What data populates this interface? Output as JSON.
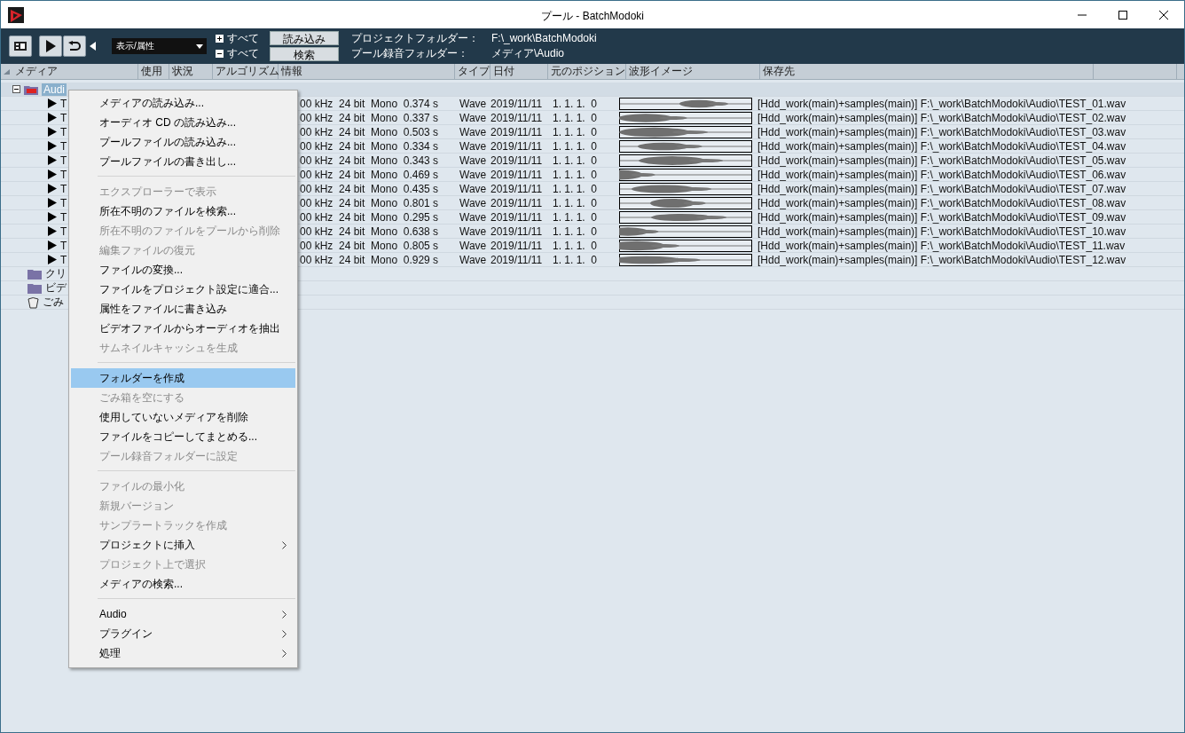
{
  "window": {
    "title": "プール - BatchModoki"
  },
  "toolbar": {
    "view_dropdown": "表示/属性",
    "expand_all": "すべて",
    "collapse_all": "すべて",
    "buttons": [
      "読み込み",
      "検索"
    ],
    "fields": [
      {
        "label": "プロジェクトフォルダー：",
        "value": "F:\\_work\\BatchModoki"
      },
      {
        "label": "プール録音フォルダー：",
        "value": "メディア\\Audio"
      }
    ]
  },
  "table": {
    "columns": [
      "メディア",
      "使用",
      "状況",
      "アルゴリズム",
      "情報",
      "タイプ",
      "日付",
      "元のポジション",
      "波形イメージ",
      "保存先"
    ],
    "folders": [
      {
        "name": "Audi",
        "kind": "audio",
        "expanded": true,
        "selected": true,
        "children": [
          {
            "name": "T",
            "info": "00 kHz  24 bit  Mono  0.374 s",
            "type": "Wave",
            "date": "2019/11/11",
            "position": "1. 1. 1.  0",
            "path": "[Hdd_work(main)+samples(main)] F:\\_work\\BatchModoki\\Audio\\TEST_01.wav"
          },
          {
            "name": "T",
            "info": "00 kHz  24 bit  Mono  0.337 s",
            "type": "Wave",
            "date": "2019/11/11",
            "position": "1. 1. 1.  0",
            "path": "[Hdd_work(main)+samples(main)] F:\\_work\\BatchModoki\\Audio\\TEST_02.wav"
          },
          {
            "name": "T",
            "info": "00 kHz  24 bit  Mono  0.503 s",
            "type": "Wave",
            "date": "2019/11/11",
            "position": "1. 1. 1.  0",
            "path": "[Hdd_work(main)+samples(main)] F:\\_work\\BatchModoki\\Audio\\TEST_03.wav"
          },
          {
            "name": "T",
            "info": "00 kHz  24 bit  Mono  0.334 s",
            "type": "Wave",
            "date": "2019/11/11",
            "position": "1. 1. 1.  0",
            "path": "[Hdd_work(main)+samples(main)] F:\\_work\\BatchModoki\\Audio\\TEST_04.wav"
          },
          {
            "name": "T",
            "info": "00 kHz  24 bit  Mono  0.343 s",
            "type": "Wave",
            "date": "2019/11/11",
            "position": "1. 1. 1.  0",
            "path": "[Hdd_work(main)+samples(main)] F:\\_work\\BatchModoki\\Audio\\TEST_05.wav"
          },
          {
            "name": "T",
            "info": "00 kHz  24 bit  Mono  0.469 s",
            "type": "Wave",
            "date": "2019/11/11",
            "position": "1. 1. 1.  0",
            "path": "[Hdd_work(main)+samples(main)] F:\\_work\\BatchModoki\\Audio\\TEST_06.wav"
          },
          {
            "name": "T",
            "info": "00 kHz  24 bit  Mono  0.435 s",
            "type": "Wave",
            "date": "2019/11/11",
            "position": "1. 1. 1.  0",
            "path": "[Hdd_work(main)+samples(main)] F:\\_work\\BatchModoki\\Audio\\TEST_07.wav"
          },
          {
            "name": "T",
            "info": "00 kHz  24 bit  Mono  0.801 s",
            "type": "Wave",
            "date": "2019/11/11",
            "position": "1. 1. 1.  0",
            "path": "[Hdd_work(main)+samples(main)] F:\\_work\\BatchModoki\\Audio\\TEST_08.wav"
          },
          {
            "name": "T",
            "info": "00 kHz  24 bit  Mono  0.295 s",
            "type": "Wave",
            "date": "2019/11/11",
            "position": "1. 1. 1.  0",
            "path": "[Hdd_work(main)+samples(main)] F:\\_work\\BatchModoki\\Audio\\TEST_09.wav"
          },
          {
            "name": "T",
            "info": "00 kHz  24 bit  Mono  0.638 s",
            "type": "Wave",
            "date": "2019/11/11",
            "position": "1. 1. 1.  0",
            "path": "[Hdd_work(main)+samples(main)] F:\\_work\\BatchModoki\\Audio\\TEST_10.wav"
          },
          {
            "name": "T",
            "info": "00 kHz  24 bit  Mono  0.805 s",
            "type": "Wave",
            "date": "2019/11/11",
            "position": "1. 1. 1.  0",
            "path": "[Hdd_work(main)+samples(main)] F:\\_work\\BatchModoki\\Audio\\TEST_11.wav"
          },
          {
            "name": "T",
            "info": "00 kHz  24 bit  Mono  0.929 s",
            "type": "Wave",
            "date": "2019/11/11",
            "position": "1. 1. 1.  0",
            "path": "[Hdd_work(main)+samples(main)] F:\\_work\\BatchModoki\\Audio\\TEST_12.wav"
          }
        ]
      },
      {
        "name": "クリ",
        "kind": "folder",
        "selected": false
      },
      {
        "name": "ビデ",
        "kind": "folder",
        "selected": false
      },
      {
        "name": "ごみ",
        "kind": "trash",
        "selected": false
      }
    ]
  },
  "context_menu": {
    "items": [
      {
        "kind": "item",
        "label": "メディアの読み込み...",
        "disabled": false,
        "selected": false,
        "submenu": false
      },
      {
        "kind": "item",
        "label": "オーディオ CD の読み込み...",
        "disabled": false,
        "selected": false,
        "submenu": false
      },
      {
        "kind": "item",
        "label": "プールファイルの読み込み...",
        "disabled": false,
        "selected": false,
        "submenu": false
      },
      {
        "kind": "item",
        "label": "プールファイルの書き出し...",
        "disabled": false,
        "selected": false,
        "submenu": false
      },
      {
        "kind": "separator"
      },
      {
        "kind": "item",
        "label": "エクスプローラーで表示",
        "disabled": true,
        "selected": false,
        "submenu": false
      },
      {
        "kind": "item",
        "label": "所在不明のファイルを検索...",
        "disabled": false,
        "selected": false,
        "submenu": false
      },
      {
        "kind": "item",
        "label": "所在不明のファイルをプールから削除",
        "disabled": true,
        "selected": false,
        "submenu": false
      },
      {
        "kind": "item",
        "label": "編集ファイルの復元",
        "disabled": true,
        "selected": false,
        "submenu": false
      },
      {
        "kind": "item",
        "label": "ファイルの変換...",
        "disabled": false,
        "selected": false,
        "submenu": false
      },
      {
        "kind": "item",
        "label": "ファイルをプロジェクト設定に適合...",
        "disabled": false,
        "selected": false,
        "submenu": false
      },
      {
        "kind": "item",
        "label": "属性をファイルに書き込み",
        "disabled": false,
        "selected": false,
        "submenu": false
      },
      {
        "kind": "item",
        "label": "ビデオファイルからオーディオを抽出",
        "disabled": false,
        "selected": false,
        "submenu": false
      },
      {
        "kind": "item",
        "label": "サムネイルキャッシュを生成",
        "disabled": true,
        "selected": false,
        "submenu": false
      },
      {
        "kind": "separator"
      },
      {
        "kind": "item",
        "label": "フォルダーを作成",
        "disabled": false,
        "selected": true,
        "submenu": false
      },
      {
        "kind": "item",
        "label": "ごみ箱を空にする",
        "disabled": true,
        "selected": false,
        "submenu": false
      },
      {
        "kind": "item",
        "label": "使用していないメディアを削除",
        "disabled": false,
        "selected": false,
        "submenu": false
      },
      {
        "kind": "item",
        "label": "ファイルをコピーしてまとめる...",
        "disabled": false,
        "selected": false,
        "submenu": false
      },
      {
        "kind": "item",
        "label": "プール録音フォルダーに設定",
        "disabled": true,
        "selected": false,
        "submenu": false
      },
      {
        "kind": "separator"
      },
      {
        "kind": "item",
        "label": "ファイルの最小化",
        "disabled": true,
        "selected": false,
        "submenu": false
      },
      {
        "kind": "item",
        "label": "新規バージョン",
        "disabled": true,
        "selected": false,
        "submenu": false
      },
      {
        "kind": "item",
        "label": "サンプラートラックを作成",
        "disabled": true,
        "selected": false,
        "submenu": false
      },
      {
        "kind": "item",
        "label": "プロジェクトに挿入",
        "disabled": false,
        "selected": false,
        "submenu": true
      },
      {
        "kind": "item",
        "label": "プロジェクト上で選択",
        "disabled": true,
        "selected": false,
        "submenu": false
      },
      {
        "kind": "item",
        "label": "メディアの検索...",
        "disabled": false,
        "selected": false,
        "submenu": false
      },
      {
        "kind": "separator"
      },
      {
        "kind": "item",
        "label": "Audio",
        "disabled": false,
        "selected": false,
        "submenu": true
      },
      {
        "kind": "item",
        "label": "プラグイン",
        "disabled": false,
        "selected": false,
        "submenu": true
      },
      {
        "kind": "item",
        "label": "処理",
        "disabled": false,
        "selected": false,
        "submenu": true
      }
    ]
  }
}
